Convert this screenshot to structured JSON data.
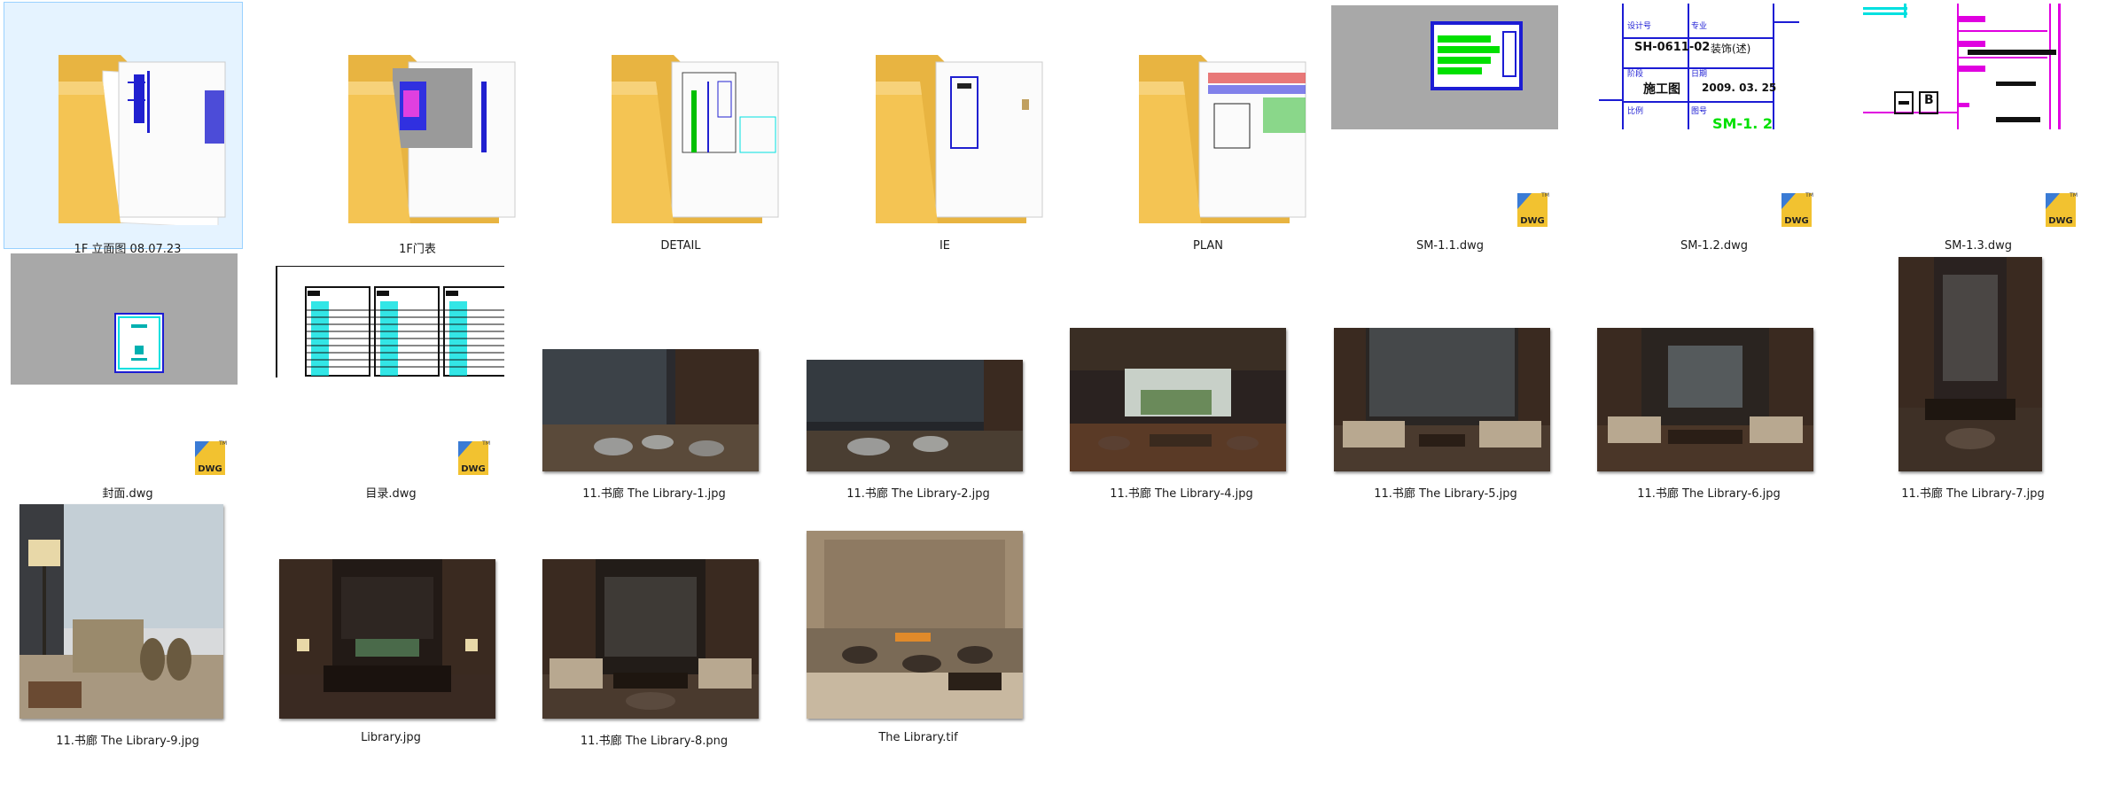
{
  "view": "large-icons",
  "colors": {
    "selection_bg": "#e5f3ff",
    "selection_border": "#99d1ff",
    "folder_yellow": "#f4c453",
    "cad_blue": "#1c1cd4",
    "cad_cyan": "#00e0e0",
    "cad_magenta": "#e000e0",
    "cad_green": "#00e000",
    "dwg_badge_yellow": "#f2c230"
  },
  "items": [
    {
      "label": "1F  立面图 08.07.23",
      "type": "folder",
      "selected": true
    },
    {
      "label": "1F门表",
      "type": "folder"
    },
    {
      "label": "DETAIL",
      "type": "folder"
    },
    {
      "label": "IE",
      "type": "folder"
    },
    {
      "label": "PLAN",
      "type": "folder"
    },
    {
      "label": "SM-1.1.dwg",
      "type": "dwg"
    },
    {
      "label": "SM-1.2.dwg",
      "type": "dwg",
      "preview": {
        "c1": "设计号",
        "c2": "专业",
        "v1": "SH-0611-02",
        "v2": "装饰(述)",
        "c3": "阶段",
        "c4": "日期",
        "v3": "施工图",
        "v4": "2009. 03. 25",
        "c5": "比例",
        "c6": "图号",
        "v6": "SM-1. 2"
      }
    },
    {
      "label": "SM-1.3.dwg",
      "type": "dwg",
      "preview": {
        "mark": "B"
      }
    },
    {
      "label": "封面.dwg",
      "type": "dwg"
    },
    {
      "label": "目录.dwg",
      "type": "dwg"
    },
    {
      "label": "11.书廊 The Library-1.jpg",
      "type": "image"
    },
    {
      "label": "11.书廊 The Library-2.jpg",
      "type": "image"
    },
    {
      "label": "11.书廊 The Library-4.jpg",
      "type": "image"
    },
    {
      "label": "11.书廊 The Library-5.jpg",
      "type": "image"
    },
    {
      "label": "11.书廊 The Library-6.jpg",
      "type": "image"
    },
    {
      "label": "11.书廊 The Library-7.jpg",
      "type": "image"
    },
    {
      "label": "11.书廊 The Library-9.jpg",
      "type": "image"
    },
    {
      "label": "Library.jpg",
      "type": "image"
    },
    {
      "label": "11.书廊 The Library-8.png",
      "type": "image"
    },
    {
      "label": "The Library.tif",
      "type": "image"
    }
  ],
  "badge_text": "DWG",
  "badge_tm": "TM"
}
